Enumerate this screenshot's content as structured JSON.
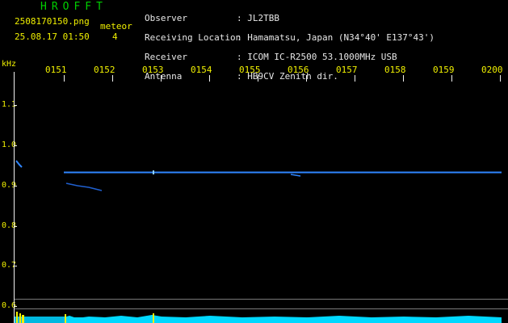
{
  "app": {
    "title": "HROFFT"
  },
  "file": {
    "name": "2508170150.png",
    "datetime": "25.08.17 01:50"
  },
  "meteor": {
    "label": "meteor",
    "count": "4"
  },
  "station": {
    "rows": [
      {
        "key": "Observer",
        "value": ": JL2TBB"
      },
      {
        "key": "Receiving Location",
        "value": ": Hamamatsu, Japan (N34°40' E137°43')"
      },
      {
        "key": "Receiver",
        "value": ": ICOM IC-R2500 53.1000MHz USB"
      },
      {
        "key": "Antenna",
        "value": ": HB9CV Zenith dir."
      }
    ]
  },
  "axis": {
    "y_unit": "kHz",
    "time_labels": [
      "0151",
      "0152",
      "0153",
      "0154",
      "0155",
      "0156",
      "0157",
      "0158",
      "0159",
      "0200"
    ],
    "freq_labels": [
      "1.1",
      "1.0",
      "0.9",
      "0.8",
      "0.7",
      "0.6"
    ]
  },
  "colors": {
    "yellow": "#f0f000",
    "green": "#00d000",
    "signal": "#2f86ff",
    "spectrum": "#00d8ff"
  }
}
